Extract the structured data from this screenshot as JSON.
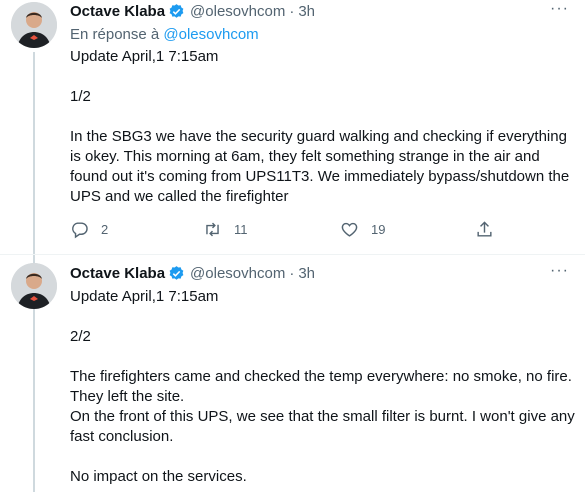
{
  "tweets": [
    {
      "author_name": "Octave Klaba",
      "handle": "@olesovhcom",
      "separator": "·",
      "time": "3h",
      "more": "···",
      "reply_prefix": "En réponse à ",
      "reply_handle": "@olesovhcom",
      "text": "Update April,1 7:15am\n\n1/2\n\nIn the SBG3 we have the security guard walking and checking if everything is okey. This morning at 6am, they felt something strange in the air and found out it's coming from UPS11T3. We immediately bypass/shutdown the UPS and we called the firefighter",
      "actions": {
        "reply_count": "2",
        "retweet_count": "11",
        "like_count": "19"
      }
    },
    {
      "author_name": "Octave Klaba",
      "handle": "@olesovhcom",
      "separator": "·",
      "time": "3h",
      "more": "···",
      "text": "Update April,1 7:15am\n\n2/2\n\nThe firefighters came and checked the temp everywhere: no smoke, no fire. They left the site.\nOn the front of this UPS, we see that the small filter is burnt. I won't give any fast conclusion.\n\nNo impact on the services."
    }
  ],
  "colors": {
    "accent": "#1d9bf0",
    "secondary_text": "#536471",
    "primary_text": "#0f1419"
  },
  "icons": {
    "verified": "verified-badge-icon",
    "reply": "reply-icon",
    "retweet": "retweet-icon",
    "like": "heart-icon",
    "share": "share-icon"
  }
}
